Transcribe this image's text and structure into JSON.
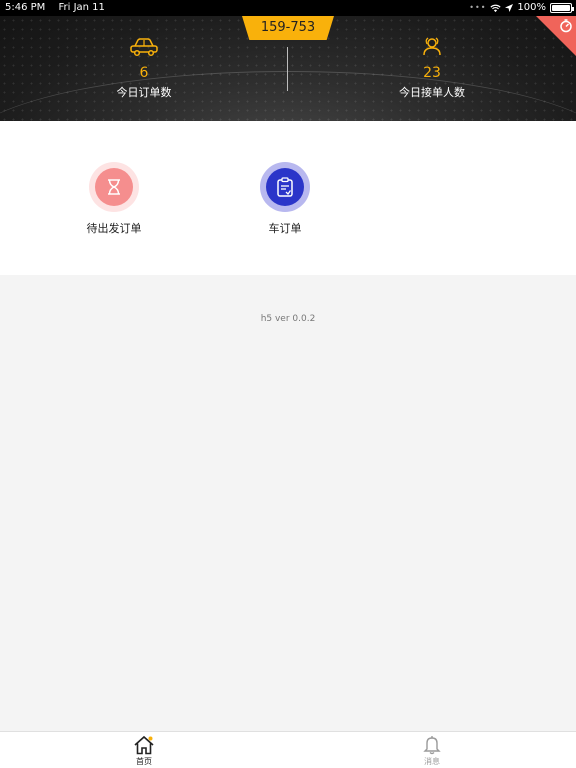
{
  "status_bar": {
    "time": "5:46 PM",
    "date": "Fri Jan 11",
    "battery": "100%"
  },
  "header": {
    "plate": "159-753",
    "stats": [
      {
        "value": "6",
        "label": "今日订单数",
        "icon": "car-icon"
      },
      {
        "value": "23",
        "label": "今日接单人数",
        "icon": "passengers-icon"
      }
    ],
    "corner_icon": "timer-icon"
  },
  "menu": {
    "items": [
      {
        "label": "待出发订单",
        "icon": "hourglass-icon"
      },
      {
        "label": "车订单",
        "icon": "clipboard-icon"
      }
    ]
  },
  "version": "h5 ver 0.0.2",
  "tabbar": {
    "items": [
      {
        "label": "首页",
        "icon": "home-icon",
        "active": true
      },
      {
        "label": "消息",
        "icon": "bell-icon",
        "active": false
      }
    ]
  },
  "colors": {
    "accent": "#f9b10b",
    "badge": "#f0645a",
    "pending_circle": "#f58e8e",
    "car_circle": "#2b35c9"
  }
}
